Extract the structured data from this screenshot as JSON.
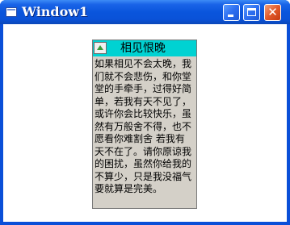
{
  "window": {
    "title": "Window1"
  },
  "title_buttons": {
    "minimize_icon": "minimize-icon",
    "maximize_icon": "maximize-icon",
    "close_icon": "close-icon",
    "close_glyph": "✕"
  },
  "panel": {
    "title": "相见恨晚",
    "header_button_icon": "triangle-up-icon",
    "body_text": "如果相见不会太晚，我们就不会悲伤，和你堂堂的手牵手，过得好简单，若我有天不见了，或许你会比较快乐，虽然有万般舍不得，也不愿看你难割舍 若我有天不在了。请你原谅我的困扰，虽然你给我的不算少，只是我没福气要就算是完美。"
  },
  "colors": {
    "title_bar": "#0a55dc",
    "panel_header": "#00d2d2",
    "panel_background": "#d4d0c8",
    "close_button": "#e25a2a"
  }
}
